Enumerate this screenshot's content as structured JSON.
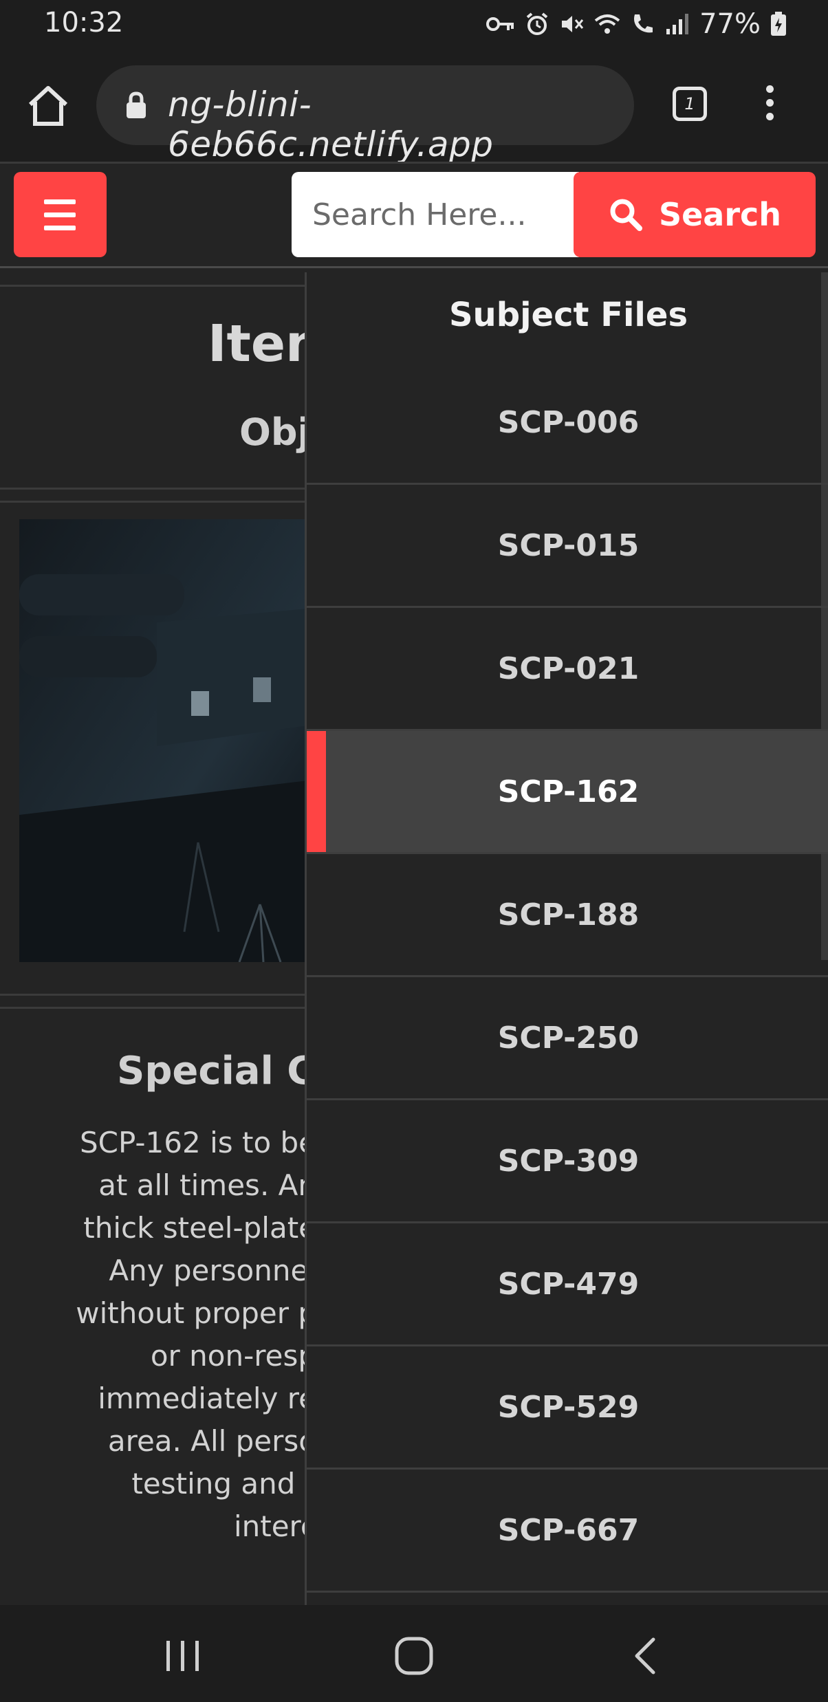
{
  "status_bar": {
    "time": "10:32",
    "battery": "77%",
    "icons": [
      "key-icon",
      "alarm-icon",
      "mute-icon",
      "wifi-icon",
      "wifi-call-icon",
      "signal-icon",
      "battery-icon"
    ]
  },
  "browser": {
    "url": "ng-blini-6eb66c.netlify.app",
    "tab_count": "1"
  },
  "header": {
    "search_placeholder": "Search Here...",
    "search_label": "Search"
  },
  "article": {
    "title_fragment": "Item",
    "class_fragment": "Obj",
    "section_heading_fragment": "Special Co",
    "body_fragments": [
      "SCP-162 is to be",
      "at all times. An",
      "thick steel-plate",
      "Any personnel",
      "without proper p",
      "or non-resp",
      "immediately re",
      "area. All perso",
      "testing and r",
      "interc"
    ]
  },
  "side_menu": {
    "title": "Subject Files",
    "items": [
      "SCP-006",
      "SCP-015",
      "SCP-021",
      "SCP-162",
      "SCP-188",
      "SCP-250",
      "SCP-309",
      "SCP-479",
      "SCP-529",
      "SCP-667"
    ],
    "active_item": "SCP-162"
  },
  "colors": {
    "accent": "#ff4444",
    "background": "#242424",
    "active_row": "#424242"
  }
}
